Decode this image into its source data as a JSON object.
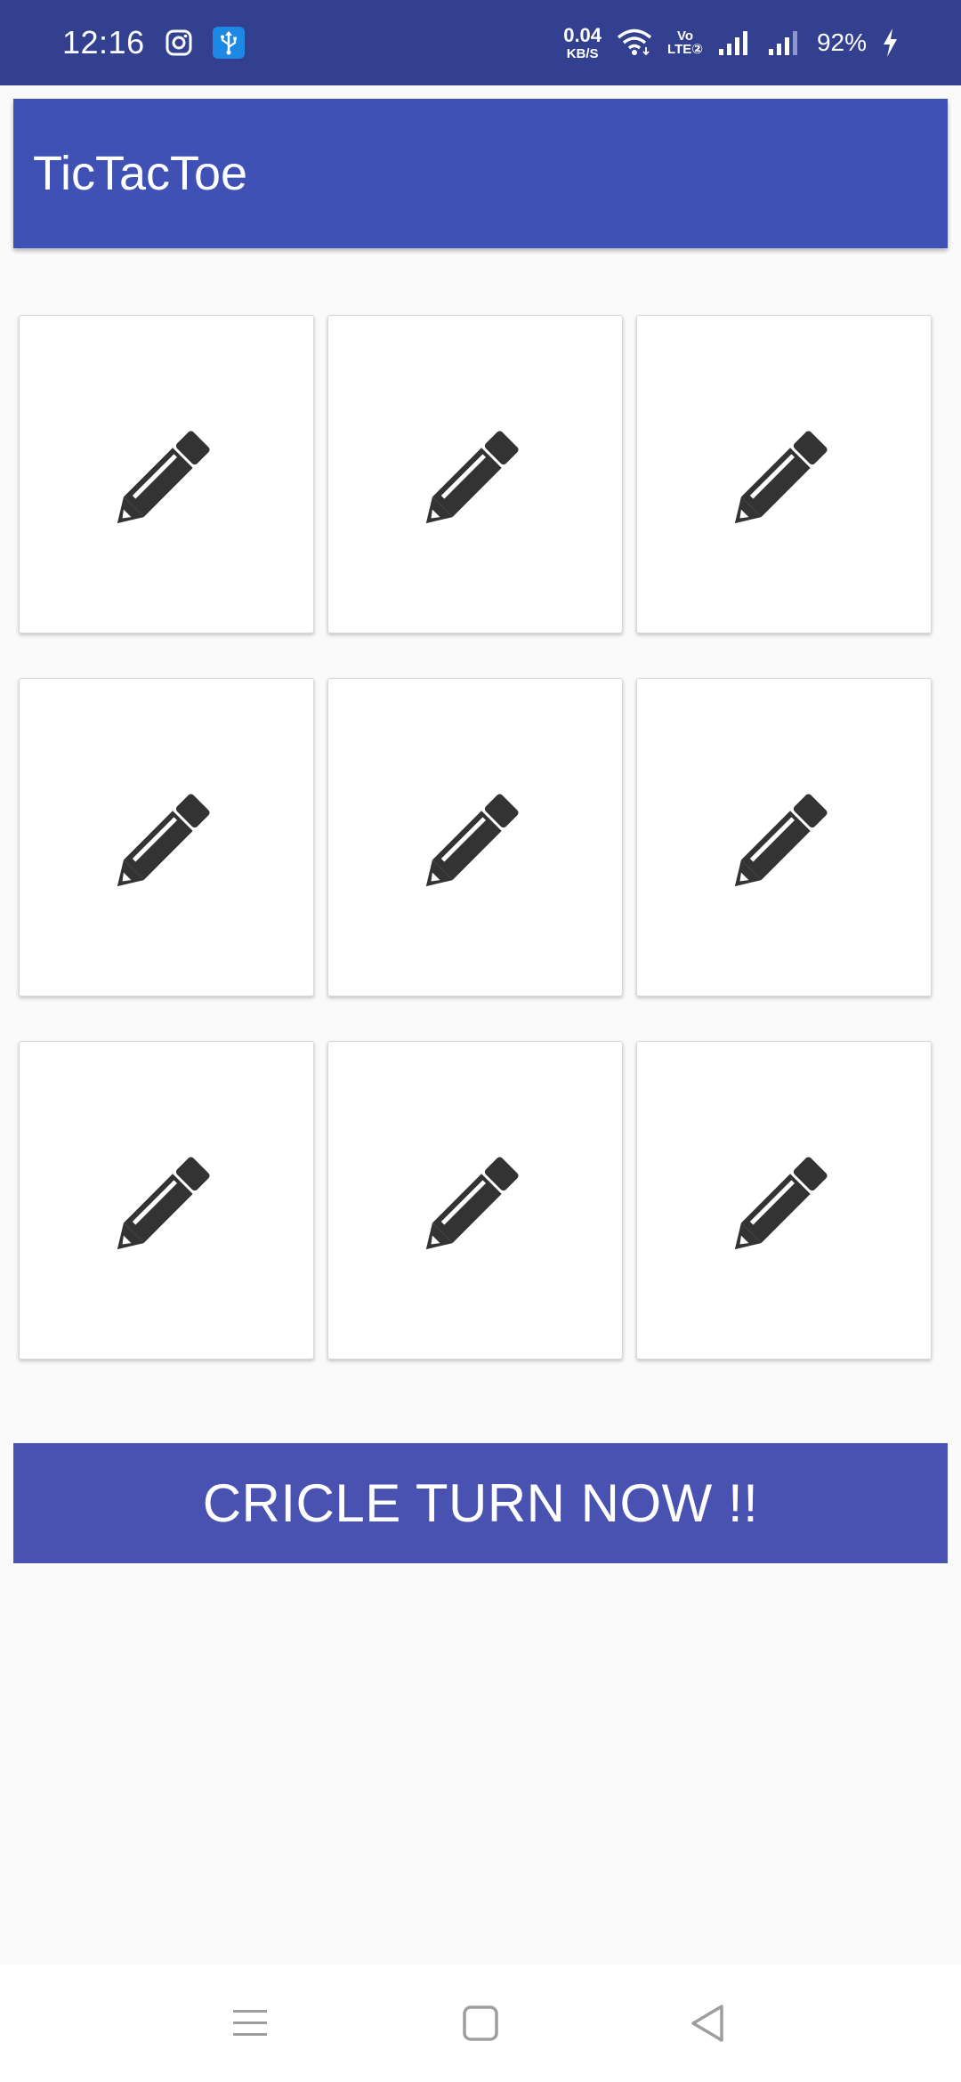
{
  "status_bar": {
    "time": "12:16",
    "net_speed_value": "0.04",
    "net_speed_unit": "KB/S",
    "volte_top": "Vo",
    "volte_bottom": "LTE②",
    "battery": "92%",
    "icons": [
      "instagram-icon",
      "usb-icon",
      "wifi-icon",
      "signal-icon",
      "signal-icon",
      "charging-icon"
    ]
  },
  "app_bar": {
    "title": "TicTacToe",
    "color": "#3f51b5"
  },
  "board": {
    "cells": [
      {
        "icon": "pencil-icon",
        "mark": ""
      },
      {
        "icon": "pencil-icon",
        "mark": ""
      },
      {
        "icon": "pencil-icon",
        "mark": ""
      },
      {
        "icon": "pencil-icon",
        "mark": ""
      },
      {
        "icon": "pencil-icon",
        "mark": ""
      },
      {
        "icon": "pencil-icon",
        "mark": ""
      },
      {
        "icon": "pencil-icon",
        "mark": ""
      },
      {
        "icon": "pencil-icon",
        "mark": ""
      },
      {
        "icon": "pencil-icon",
        "mark": ""
      }
    ]
  },
  "turn_banner": {
    "text": "CRICLE TURN NOW !!",
    "color": "#4a52b1"
  },
  "nav_bar": {
    "buttons": [
      "recents-icon",
      "home-icon",
      "back-icon"
    ]
  }
}
